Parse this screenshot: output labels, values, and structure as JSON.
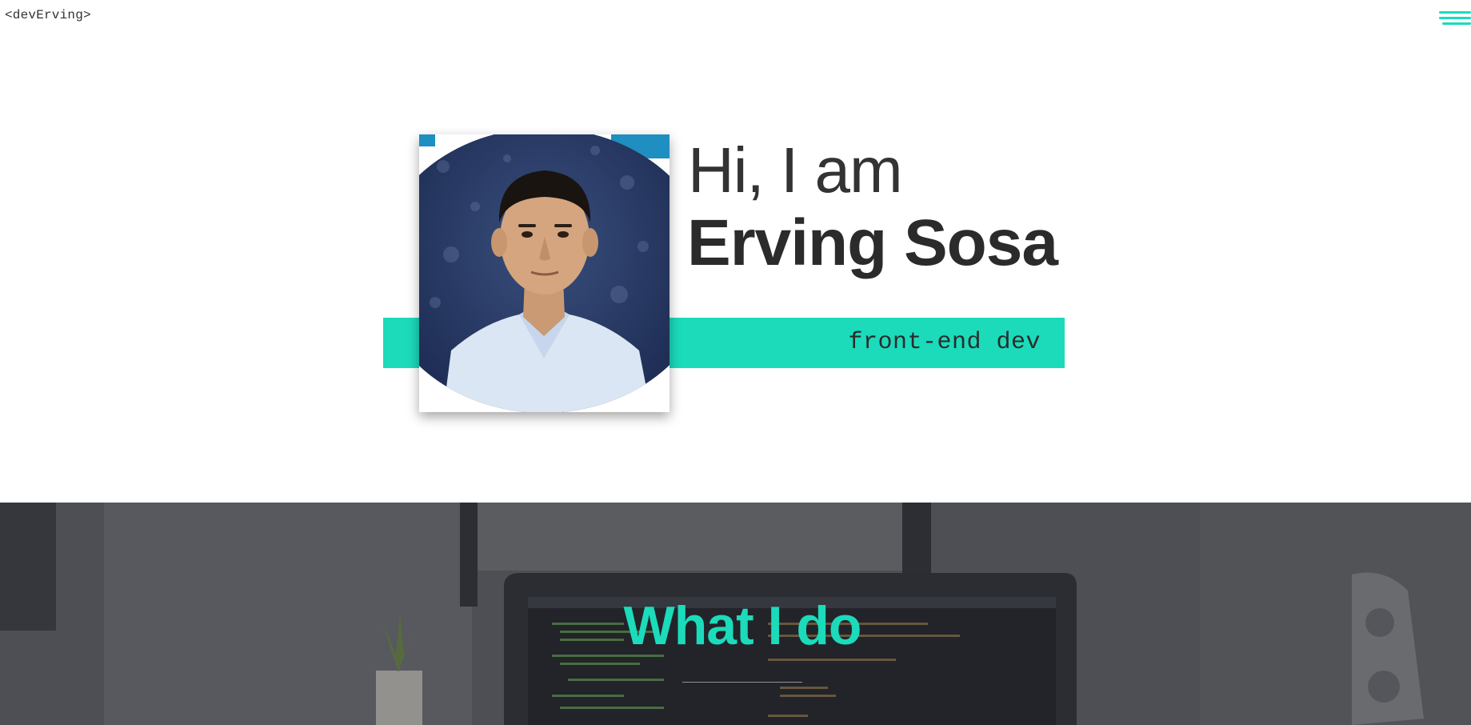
{
  "header": {
    "logo_text": "<devErving>",
    "menu_icon": "hamburger-menu-icon"
  },
  "hero": {
    "greeting": "Hi, I am",
    "name": "Erving Sosa",
    "role": "front-end dev",
    "photo_alt": "portrait-photo"
  },
  "section": {
    "title": "What I do"
  },
  "colors": {
    "accent": "#1bdbbb",
    "text": "#2b2b2b",
    "section_overlay": "#55585c"
  }
}
